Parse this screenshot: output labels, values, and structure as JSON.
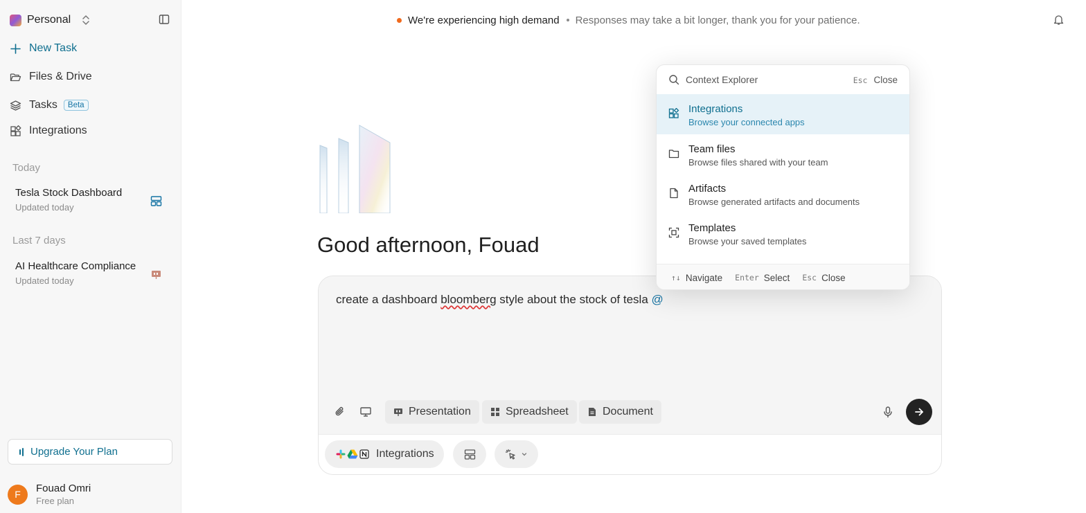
{
  "sidebar": {
    "workspace": "Personal",
    "nav": {
      "new_task": "New Task",
      "files": "Files & Drive",
      "tasks": "Tasks",
      "tasks_badge": "Beta",
      "integrations": "Integrations"
    },
    "sections": {
      "today": "Today",
      "last7": "Last 7 days"
    },
    "history": [
      {
        "title": "Tesla Stock Dashboard",
        "subtitle": "Updated today",
        "icon": "dashboard-icon"
      },
      {
        "title": "AI Healthcare Compliance",
        "subtitle": "Updated today",
        "icon": "presentation-icon"
      }
    ],
    "upgrade": "Upgrade Your Plan",
    "user": {
      "initial": "F",
      "name": "Fouad Omri",
      "plan": "Free plan"
    }
  },
  "banner": {
    "headline": "We're experiencing high demand",
    "detail": "Responses may take a bit longer, thank you for your patience."
  },
  "greeting": "Good afternoon, Fouad",
  "composer": {
    "prompt_before": "create a dashboard ",
    "prompt_misspelled": "bloomberg",
    "prompt_after": " style about the stock of tesla ",
    "prompt_at": "@",
    "chips": {
      "presentation": "Presentation",
      "spreadsheet": "Spreadsheet",
      "document": "Document"
    },
    "integrations": "Integrations"
  },
  "context_explorer": {
    "title": "Context Explorer",
    "close_key": "Esc",
    "close_label": "Close",
    "items": [
      {
        "title": "Integrations",
        "description": "Browse your connected apps",
        "icon": "integrations-icon"
      },
      {
        "title": "Team files",
        "description": "Browse files shared with your team",
        "icon": "folder-icon"
      },
      {
        "title": "Artifacts",
        "description": "Browse generated artifacts and documents",
        "icon": "file-icon"
      },
      {
        "title": "Templates",
        "description": "Browse your saved templates",
        "icon": "template-icon"
      }
    ],
    "footer": {
      "navigate_key": "↑↓",
      "navigate_label": "Navigate",
      "select_key": "Enter",
      "select_label": "Select",
      "close_key": "Esc",
      "close_label": "Close"
    }
  },
  "colors": {
    "accent": "#0f6f8f",
    "banner_dot": "#f06a1d",
    "avatar": "#ee7a1c"
  }
}
